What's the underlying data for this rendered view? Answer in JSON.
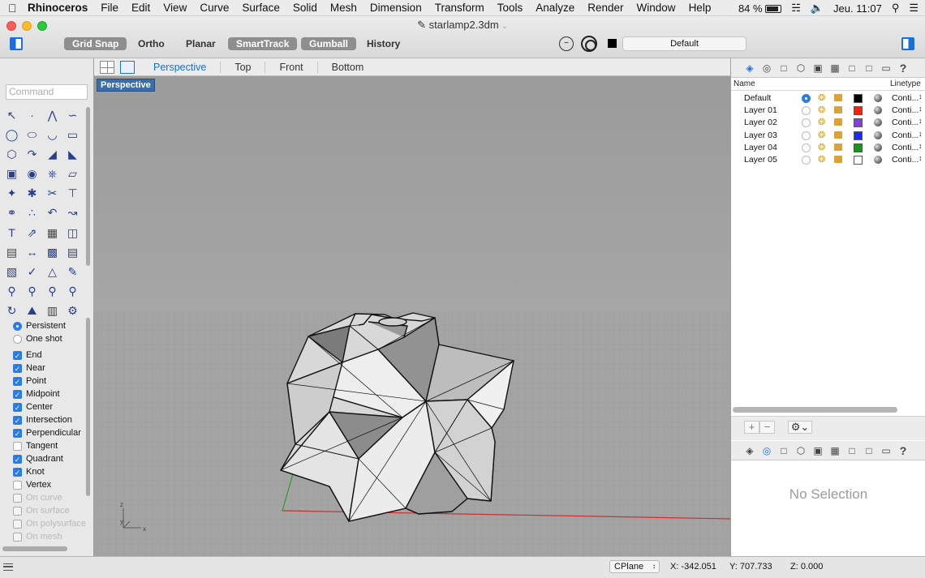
{
  "menubar": {
    "app_name": "Rhinoceros",
    "items": [
      "File",
      "Edit",
      "View",
      "Curve",
      "Surface",
      "Solid",
      "Mesh",
      "Dimension",
      "Transform",
      "Tools",
      "Analyze",
      "Render",
      "Window",
      "Help"
    ],
    "battery": "84 %",
    "clock": "Jeu. 11:07"
  },
  "window": {
    "title": "starlamp2.3dm",
    "toolbar": {
      "grid_snap": "Grid Snap",
      "ortho": "Ortho",
      "planar": "Planar",
      "smarttrack": "SmartTrack",
      "gumball": "Gumball",
      "history": "History"
    },
    "current_layer": "Default",
    "current_layer_color": "#000000"
  },
  "command": {
    "placeholder": "Command"
  },
  "osnap": {
    "persistent": "Persistent",
    "one_shot": "One shot",
    "items": [
      {
        "label": "End",
        "checked": true,
        "enabled": true
      },
      {
        "label": "Near",
        "checked": true,
        "enabled": true
      },
      {
        "label": "Point",
        "checked": true,
        "enabled": true
      },
      {
        "label": "Midpoint",
        "checked": true,
        "enabled": true
      },
      {
        "label": "Center",
        "checked": true,
        "enabled": true
      },
      {
        "label": "Intersection",
        "checked": true,
        "enabled": true
      },
      {
        "label": "Perpendicular",
        "checked": true,
        "enabled": true
      },
      {
        "label": "Tangent",
        "checked": false,
        "enabled": true
      },
      {
        "label": "Quadrant",
        "checked": true,
        "enabled": true
      },
      {
        "label": "Knot",
        "checked": true,
        "enabled": true
      },
      {
        "label": "Vertex",
        "checked": false,
        "enabled": true
      },
      {
        "label": "On curve",
        "checked": false,
        "enabled": false
      },
      {
        "label": "On surface",
        "checked": false,
        "enabled": false
      },
      {
        "label": "On polysurface",
        "checked": false,
        "enabled": false
      },
      {
        "label": "On mesh",
        "checked": false,
        "enabled": false
      }
    ]
  },
  "viewport": {
    "tabs": [
      "Perspective",
      "Top",
      "Front",
      "Bottom"
    ],
    "active_tab": "Perspective",
    "label": "Perspective",
    "axes": {
      "z": "z",
      "y": "y",
      "x": "x"
    }
  },
  "layers": {
    "headers": {
      "name": "Name",
      "linetype": "Linetype"
    },
    "rows": [
      {
        "name": "Default",
        "current": true,
        "color": "#000000",
        "linetype": "Conti..."
      },
      {
        "name": "Layer 01",
        "current": false,
        "color": "#ff2200",
        "linetype": "Conti..."
      },
      {
        "name": "Layer 02",
        "current": false,
        "color": "#8a3de0",
        "linetype": "Conti..."
      },
      {
        "name": "Layer 03",
        "current": false,
        "color": "#1a2bff",
        "linetype": "Conti..."
      },
      {
        "name": "Layer 04",
        "current": false,
        "color": "#119911",
        "linetype": "Conti..."
      },
      {
        "name": "Layer 05",
        "current": false,
        "color": "#ffffff",
        "linetype": "Conti..."
      }
    ]
  },
  "properties": {
    "empty_text": "No Selection"
  },
  "status": {
    "cplane": "CPlane",
    "x": "X: -342.051",
    "y": "Y: 707.733",
    "z": "Z: 0.000"
  }
}
